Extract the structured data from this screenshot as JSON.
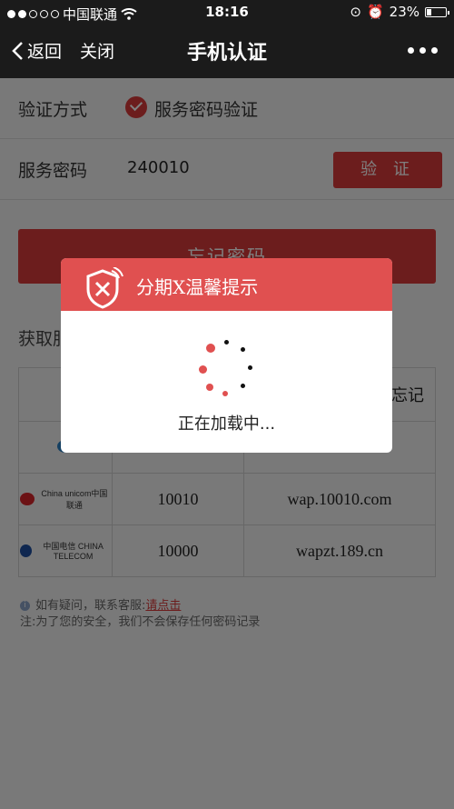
{
  "status_bar": {
    "carrier": "中国联通",
    "time": "18:16",
    "battery": "23%"
  },
  "nav": {
    "back_label": "返回",
    "close_label": "关闭",
    "title": "手机认证"
  },
  "form": {
    "method_label": "验证方式",
    "method_value": "服务密码验证",
    "password_label": "服务密码",
    "password_value": "240010",
    "verify_button": "验 证",
    "forgot_button": "忘记密码"
  },
  "section_title": "获取服务密码方式",
  "carrier_table": {
    "header_right": "忘记",
    "rows": [
      {
        "logo": "中国移动",
        "number": "",
        "site": ""
      },
      {
        "logo": "China unicom中国联通",
        "number": "10010",
        "site": "wap.10010.com"
      },
      {
        "logo": "中国电信 CHINA TELECOM",
        "number": "10000",
        "site": "wapzt.189.cn"
      }
    ]
  },
  "footer": {
    "question_text": "如有疑问，联系客服:",
    "link_text": "请点击",
    "note_text": "注:为了您的安全，我们不会保存任何密码记录"
  },
  "dialog": {
    "title": "分期X温馨提示",
    "loading_text": "正在加载中..."
  },
  "colors": {
    "accent": "#d93a3a",
    "dialog_header": "#e05050",
    "bar": "#1b1b1b"
  }
}
